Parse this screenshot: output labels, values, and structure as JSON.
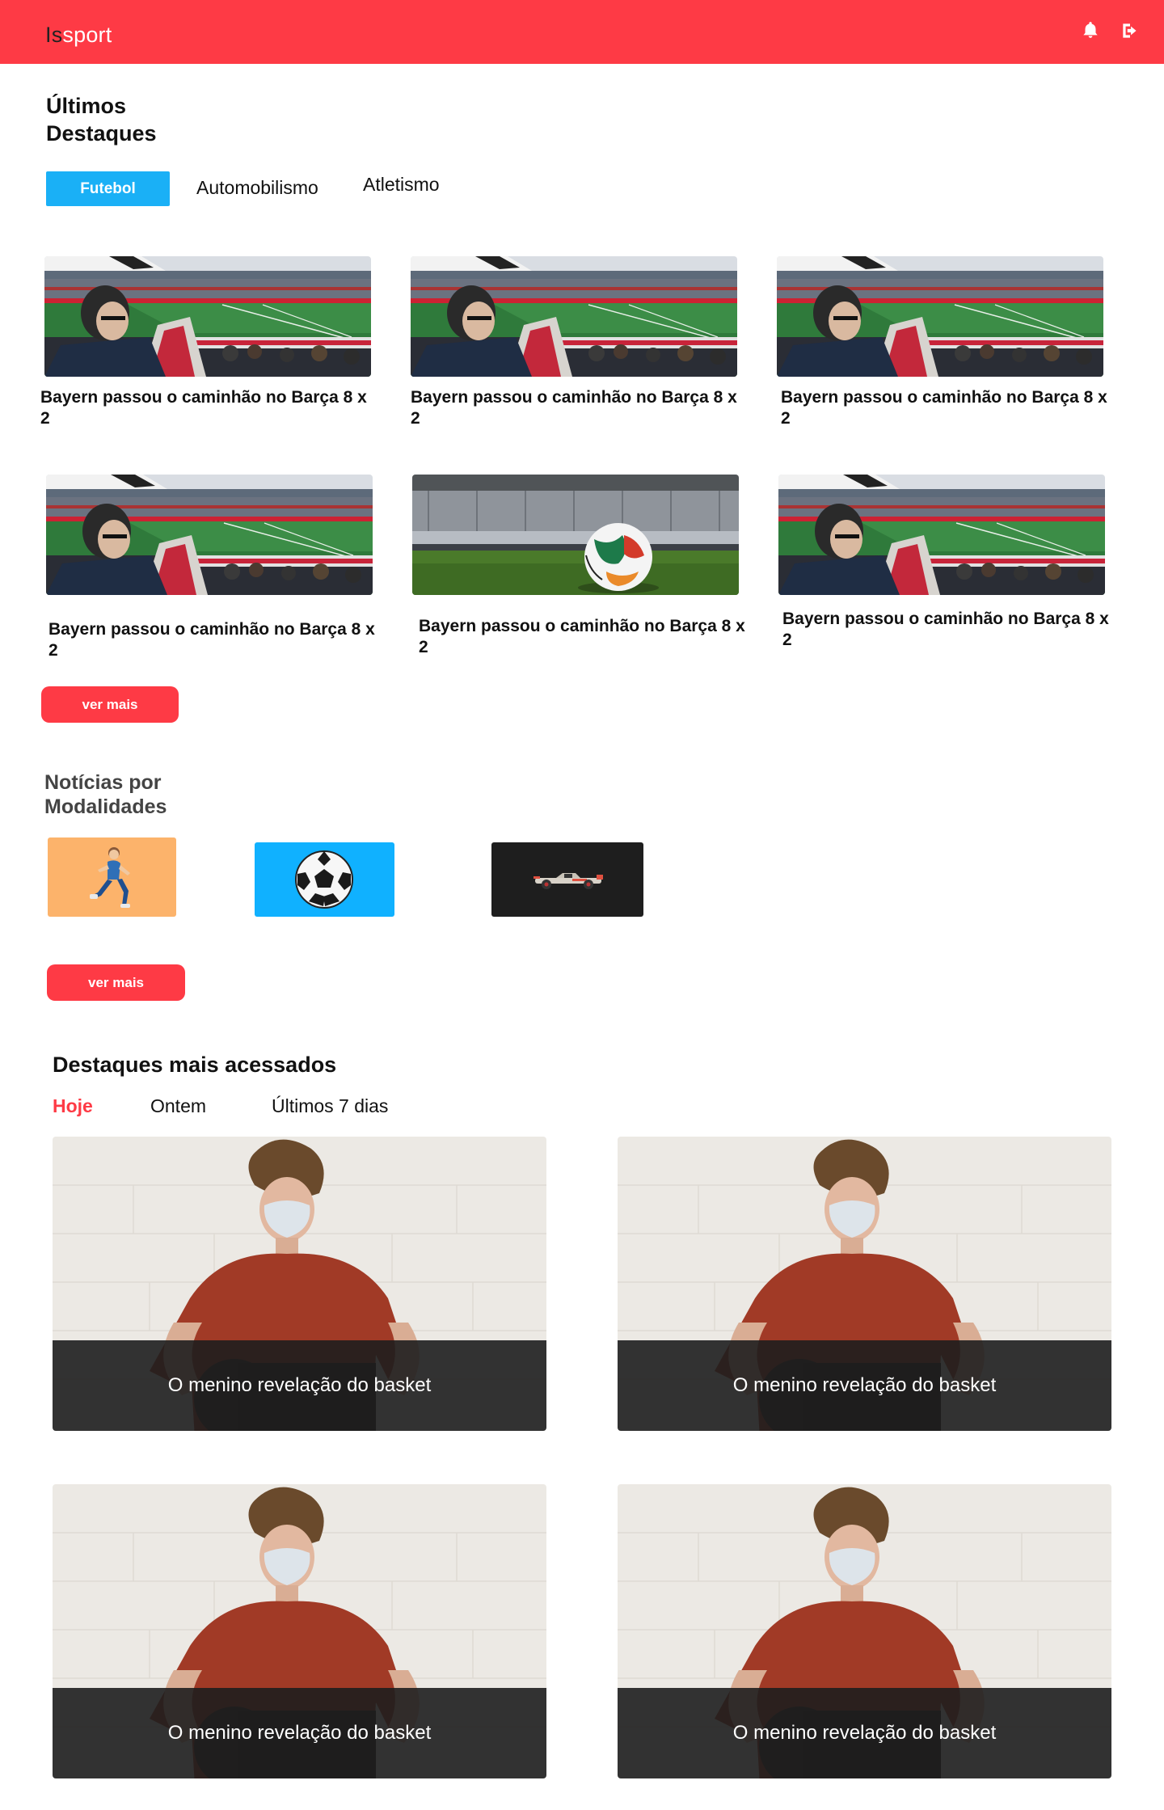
{
  "header": {
    "logo_part1": "Is",
    "logo_part2": "sport",
    "bell_icon": "bell-icon",
    "logout_icon": "sign-out-icon"
  },
  "highlights": {
    "title_line1": "Últimos",
    "title_line2": "Destaques",
    "tabs": [
      "Futebol",
      "Automobilismo",
      "Atletismo"
    ],
    "cards": [
      {
        "title": "Bayern passou o caminhão no Barça 8 x 2",
        "image": "stadium-fans"
      },
      {
        "title": "Bayern passou o caminhão no Barça 8 x 2",
        "image": "stadium-fans"
      },
      {
        "title": "Bayern passou o caminhão no Barça 8 x 2",
        "image": "stadium-fans"
      },
      {
        "title": "Bayern passou o caminhão no Barça 8 x 2",
        "image": "stadium-fans"
      },
      {
        "title": "Bayern passou o caminhão no Barça 8 x 2",
        "image": "ball-on-pitch"
      },
      {
        "title": "Bayern passou o caminhão no Barça 8 x 2",
        "image": "stadium-fans"
      }
    ],
    "more_label": "ver mais"
  },
  "modalities": {
    "title_line1": "Notícias por",
    "title_line2": "Modalidades",
    "tiles": [
      {
        "icon": "runner-icon",
        "bg": "#fcb36b"
      },
      {
        "icon": "soccer-ball-icon",
        "bg": "#10b1ff"
      },
      {
        "icon": "race-car-icon",
        "bg": "#1e1e1e"
      }
    ],
    "more_label": "ver mais"
  },
  "most_accessed": {
    "title": "Destaques mais acessados",
    "tabs": [
      "Hoje",
      "Ontem",
      "Últimos 7 dias"
    ],
    "cards": [
      {
        "caption": "O menino revelação do basket"
      },
      {
        "caption": "O menino revelação do basket"
      },
      {
        "caption": "O menino revelação do basket"
      },
      {
        "caption": "O menino revelação do basket"
      }
    ]
  },
  "colors": {
    "brand_red": "#fe3a45",
    "active_blue": "#1ab0f6"
  }
}
